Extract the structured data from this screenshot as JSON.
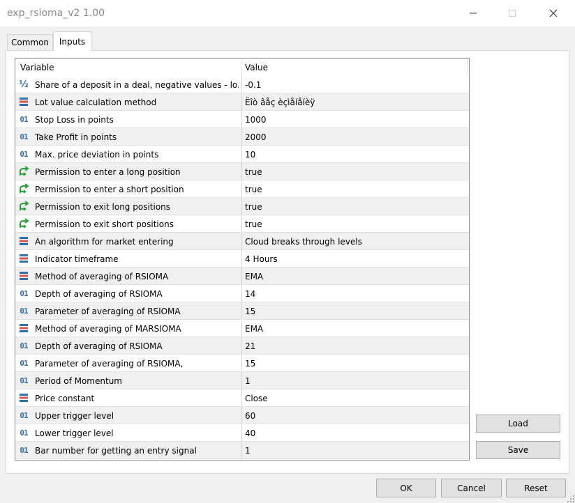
{
  "window": {
    "title": "exp_rsioma_v2 1.00"
  },
  "tabs": [
    {
      "label": "Common"
    },
    {
      "label": "Inputs"
    }
  ],
  "grid": {
    "headers": {
      "variable": "Variable",
      "value": "Value"
    },
    "rows": [
      {
        "icon": "fraction-icon",
        "name": "Share of a deposit in a deal, negative values - lo...",
        "value": "-0.1"
      },
      {
        "icon": "enum-icon",
        "name": "Lot value calculation method",
        "value": "Ëîò âåç èçìåíåíèÿ"
      },
      {
        "icon": "integer-icon",
        "name": "Stop Loss in points",
        "value": "1000"
      },
      {
        "icon": "integer-icon",
        "name": "Take Profit in points",
        "value": "2000"
      },
      {
        "icon": "integer-icon",
        "name": "Max. price deviation in points",
        "value": "10"
      },
      {
        "icon": "bool-icon",
        "name": "Permission to enter a long position",
        "value": "true"
      },
      {
        "icon": "bool-icon",
        "name": "Permission to enter a short position",
        "value": "true"
      },
      {
        "icon": "bool-icon",
        "name": "Permission to exit long positions",
        "value": "true"
      },
      {
        "icon": "bool-icon",
        "name": "Permission to exit short positions",
        "value": "true"
      },
      {
        "icon": "enum-icon",
        "name": "An algorithm for market entering",
        "value": "Cloud breaks through levels"
      },
      {
        "icon": "enum-icon",
        "name": "Indicator timeframe",
        "value": "4 Hours"
      },
      {
        "icon": "enum-icon",
        "name": "Method of averaging of RSIOMA",
        "value": "EMA"
      },
      {
        "icon": "integer-icon",
        "name": "Depth of averaging of RSIOMA",
        "value": "14"
      },
      {
        "icon": "integer-icon",
        "name": "Parameter of averaging of RSIOMA",
        "value": "15"
      },
      {
        "icon": "enum-icon",
        "name": "Method of averaging of MARSIOMA",
        "value": "EMA"
      },
      {
        "icon": "integer-icon",
        "name": "Depth of averaging of RSIOMA",
        "value": "21"
      },
      {
        "icon": "integer-icon",
        "name": "Parameter of averaging of RSIOMA,",
        "value": "15"
      },
      {
        "icon": "integer-icon",
        "name": "Period of Momentum",
        "value": "1"
      },
      {
        "icon": "enum-icon",
        "name": "Price constant",
        "value": "Close"
      },
      {
        "icon": "integer-icon",
        "name": "Upper trigger level",
        "value": "60"
      },
      {
        "icon": "integer-icon",
        "name": "Lower trigger level",
        "value": "40"
      },
      {
        "icon": "integer-icon",
        "name": "Bar number for getting an entry signal",
        "value": "1"
      }
    ]
  },
  "side_buttons": {
    "load": "Load",
    "save": "Save"
  },
  "footer_buttons": {
    "ok": "OK",
    "cancel": "Cancel",
    "reset": "Reset"
  }
}
